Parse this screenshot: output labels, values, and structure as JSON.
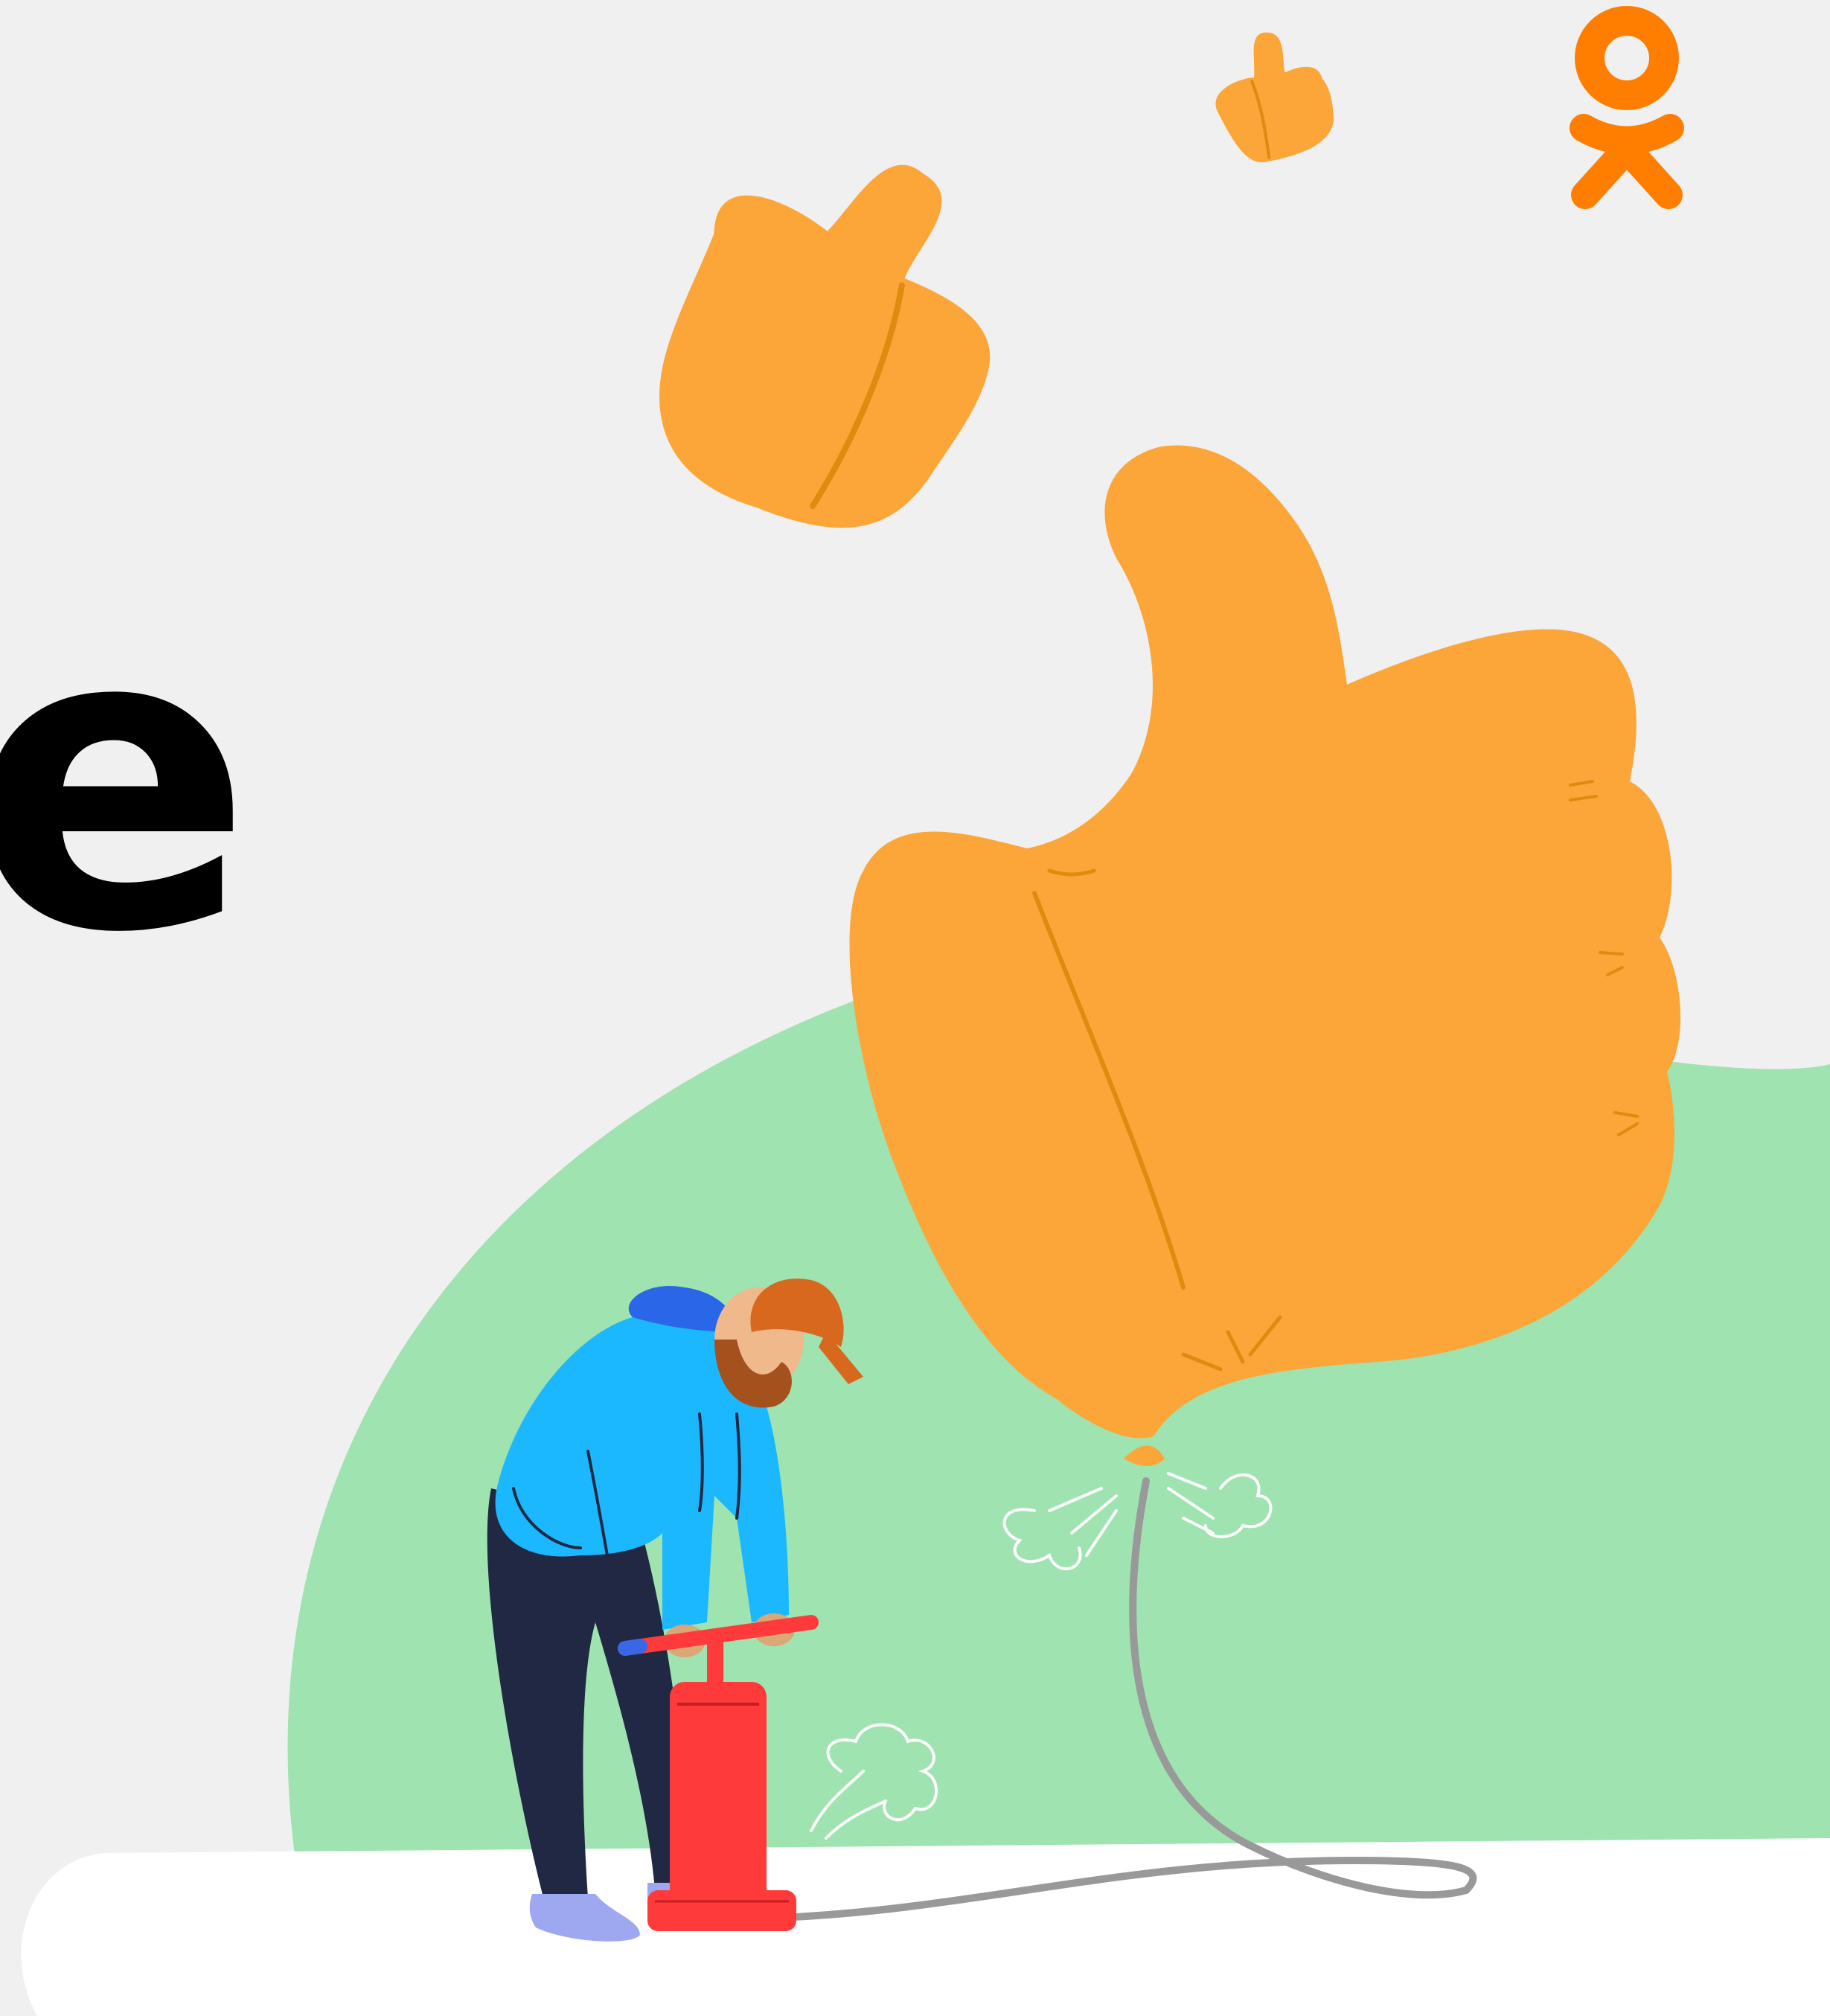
{
  "headline": {
    "visible_fragment": "e"
  },
  "brand": {
    "logo": "odnoklassniki-logo-icon",
    "color": "#ff7e00"
  },
  "colors": {
    "background": "#f0f0f0",
    "hill": "#9ee3b0",
    "thumb": "#fca63a",
    "thumb_line": "#e08a10",
    "floor": "#ffffff",
    "hoodie": "#1bb8ff",
    "pants": "#212843",
    "pump": "#ff3a3a",
    "cap": "#d9681f",
    "hose": "#999999"
  },
  "illustration": {
    "icons": [
      "thumbs-up-balloon-icon",
      "thumbs-up-small-icon",
      "thumbs-up-tiny-icon",
      "air-pump-icon",
      "man-pumping-icon"
    ]
  }
}
